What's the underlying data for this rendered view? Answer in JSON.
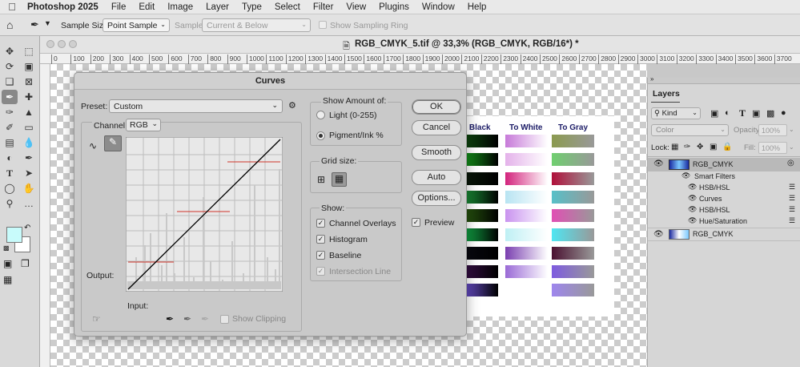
{
  "menubar": {
    "app_name": "Photoshop 2025",
    "items": [
      "File",
      "Edit",
      "Image",
      "Layer",
      "Type",
      "Select",
      "Filter",
      "View",
      "Plugins",
      "Window",
      "Help"
    ]
  },
  "options_bar": {
    "sample_size_label": "Sample Size:",
    "sample_size_value": "Point Sample",
    "sample_label": "Sample:",
    "sample_value": "Current & Below",
    "show_sampling_ring": "Show Sampling Ring"
  },
  "document": {
    "tab_title": "RGB_CMYK_5.tif @ 33,3% (RGB_CMYK, RGB/16*) *",
    "ruler_ticks": [
      "0",
      "100",
      "200",
      "300",
      "400",
      "500",
      "600",
      "700",
      "800",
      "900",
      "1000",
      "1100",
      "1200",
      "1300",
      "1400",
      "1500",
      "1600",
      "1700",
      "1800",
      "1900",
      "2000",
      "2100",
      "2200",
      "2300",
      "2400",
      "2500",
      "2600",
      "2700",
      "2800",
      "2900",
      "3000",
      "3100",
      "3200",
      "3300",
      "3400",
      "3500",
      "3600",
      "3700"
    ]
  },
  "swatch_image": {
    "column_headers": [
      "o Black",
      "To White",
      "To Gray"
    ],
    "rows": [
      [
        "#0f4d10",
        "#c77ad9",
        "#8b9a4f"
      ],
      [
        "#15a01c",
        "#e4b2ea",
        "#6fcf6f"
      ],
      [
        "#0a1a0a",
        "#d3237c",
        "#b0103a"
      ],
      [
        "#1c9a3b",
        "#b8e4f2",
        "#57c0c8"
      ],
      [
        "#2a5c10",
        "#c993ef",
        "#e14fb4"
      ],
      [
        "#13b04a",
        "#bff0f4",
        "#4fe6f2"
      ],
      [
        "#0a0a12",
        "#7a3fb0",
        "#4a1030"
      ],
      [
        "#3a0f4a",
        "#9a6ad6",
        "#7e5be0"
      ],
      [
        "#6f52d8",
        "#ffffff",
        "#9e86ee"
      ]
    ]
  },
  "curves": {
    "title": "Curves",
    "preset_label": "Preset:",
    "preset_value": "Custom",
    "channel_label": "Channel:",
    "channel_value": "RGB",
    "output_label": "Output:",
    "input_label": "Input:",
    "show_clipping": "Show Clipping",
    "show_amount_title": "Show Amount of:",
    "light_label": "Light  (0-255)",
    "pigment_label": "Pigment/Ink %",
    "grid_size_title": "Grid size:",
    "show_title": "Show:",
    "channel_overlays": "Channel Overlays",
    "histogram": "Histogram",
    "baseline": "Baseline",
    "intersection_line": "Intersection Line",
    "buttons": {
      "ok": "OK",
      "cancel": "Cancel",
      "smooth": "Smooth",
      "auto": "Auto",
      "options": "Options..."
    },
    "preview": "Preview"
  },
  "layers_panel": {
    "title": "Layers",
    "kind_label": "Kind",
    "blend_mode": "Color",
    "opacity_label": "Opacity:",
    "opacity_value": "100%",
    "lock_label": "Lock:",
    "fill_label": "Fill:",
    "fill_value": "100%",
    "layers": [
      {
        "name": "RGB_CMYK",
        "indent": 0
      },
      {
        "name": "Smart Filters",
        "indent": 1
      },
      {
        "name": "HSB/HSL",
        "indent": 2
      },
      {
        "name": "Curves",
        "indent": 2
      },
      {
        "name": "HSB/HSL",
        "indent": 2
      },
      {
        "name": "Hue/Saturation",
        "indent": 2
      },
      {
        "name": "RGB_CMYK",
        "indent": 0
      }
    ]
  },
  "colors": {
    "foreground": "#c8fbfb",
    "background": "#ffffff"
  }
}
